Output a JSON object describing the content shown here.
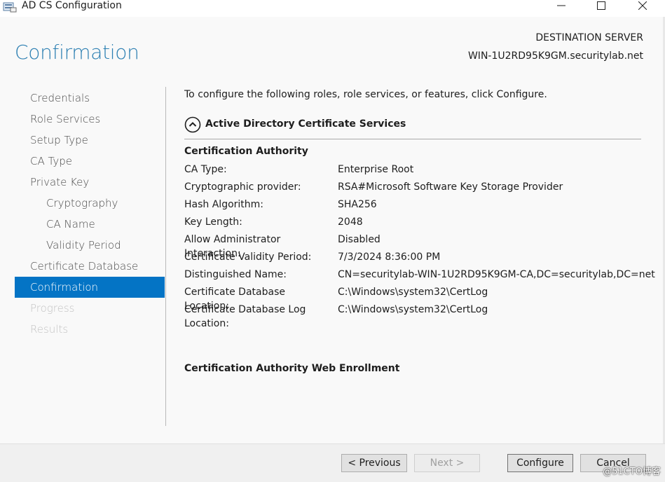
{
  "window": {
    "title": "AD CS Configuration"
  },
  "header": {
    "page_title": "Confirmation",
    "destination_label": "DESTINATION SERVER",
    "destination_server": "WIN-1U2RD95K9GM.securitylab.net"
  },
  "nav": {
    "items": [
      {
        "label": "Credentials",
        "state": "normal"
      },
      {
        "label": "Role Services",
        "state": "normal"
      },
      {
        "label": "Setup Type",
        "state": "normal"
      },
      {
        "label": "CA Type",
        "state": "normal"
      },
      {
        "label": "Private Key",
        "state": "normal"
      },
      {
        "label": "Cryptography",
        "state": "sub"
      },
      {
        "label": "CA Name",
        "state": "sub"
      },
      {
        "label": "Validity Period",
        "state": "sub"
      },
      {
        "label": "Certificate Database",
        "state": "normal"
      },
      {
        "label": "Confirmation",
        "state": "active"
      },
      {
        "label": "Progress",
        "state": "disabled"
      },
      {
        "label": "Results",
        "state": "disabled"
      }
    ]
  },
  "main": {
    "intro": "To configure the following roles, role services, or features, click Configure.",
    "section_title": "Active Directory Certificate Services",
    "group1_title": "Certification Authority",
    "details": [
      {
        "label": "CA Type:",
        "value": "Enterprise Root"
      },
      {
        "label": "Cryptographic provider:",
        "value": "RSA#Microsoft Software Key Storage Provider"
      },
      {
        "label": "Hash Algorithm:",
        "value": "SHA256"
      },
      {
        "label": "Key Length:",
        "value": "2048"
      },
      {
        "label": "Allow Administrator Interaction:",
        "value": "Disabled"
      },
      {
        "label": "Certificate Validity Period:",
        "value": "7/3/2024 8:36:00 PM"
      },
      {
        "label": "Distinguished Name:",
        "value": "CN=securitylab-WIN-1U2RD95K9GM-CA,DC=securitylab,DC=net"
      },
      {
        "label": "Certificate Database Location:",
        "value": "C:\\Windows\\system32\\CertLog"
      },
      {
        "label": "Certificate Database Log Location:",
        "value": "C:\\Windows\\system32\\CertLog"
      }
    ],
    "group2_title": "Certification Authority Web Enrollment"
  },
  "footer": {
    "previous_label": "< Previous",
    "next_label": "Next >",
    "configure_label": "Configure",
    "cancel_label": "Cancel"
  },
  "watermark": "@51CTO博客",
  "colors": {
    "accent": "#0474c5",
    "title": "#2c7fb2"
  },
  "icons": {
    "app": "server-manager-icon",
    "minimize": "minimize-icon",
    "maximize": "maximize-icon",
    "close": "close-icon",
    "collapse": "chevron-up-circle-icon"
  }
}
